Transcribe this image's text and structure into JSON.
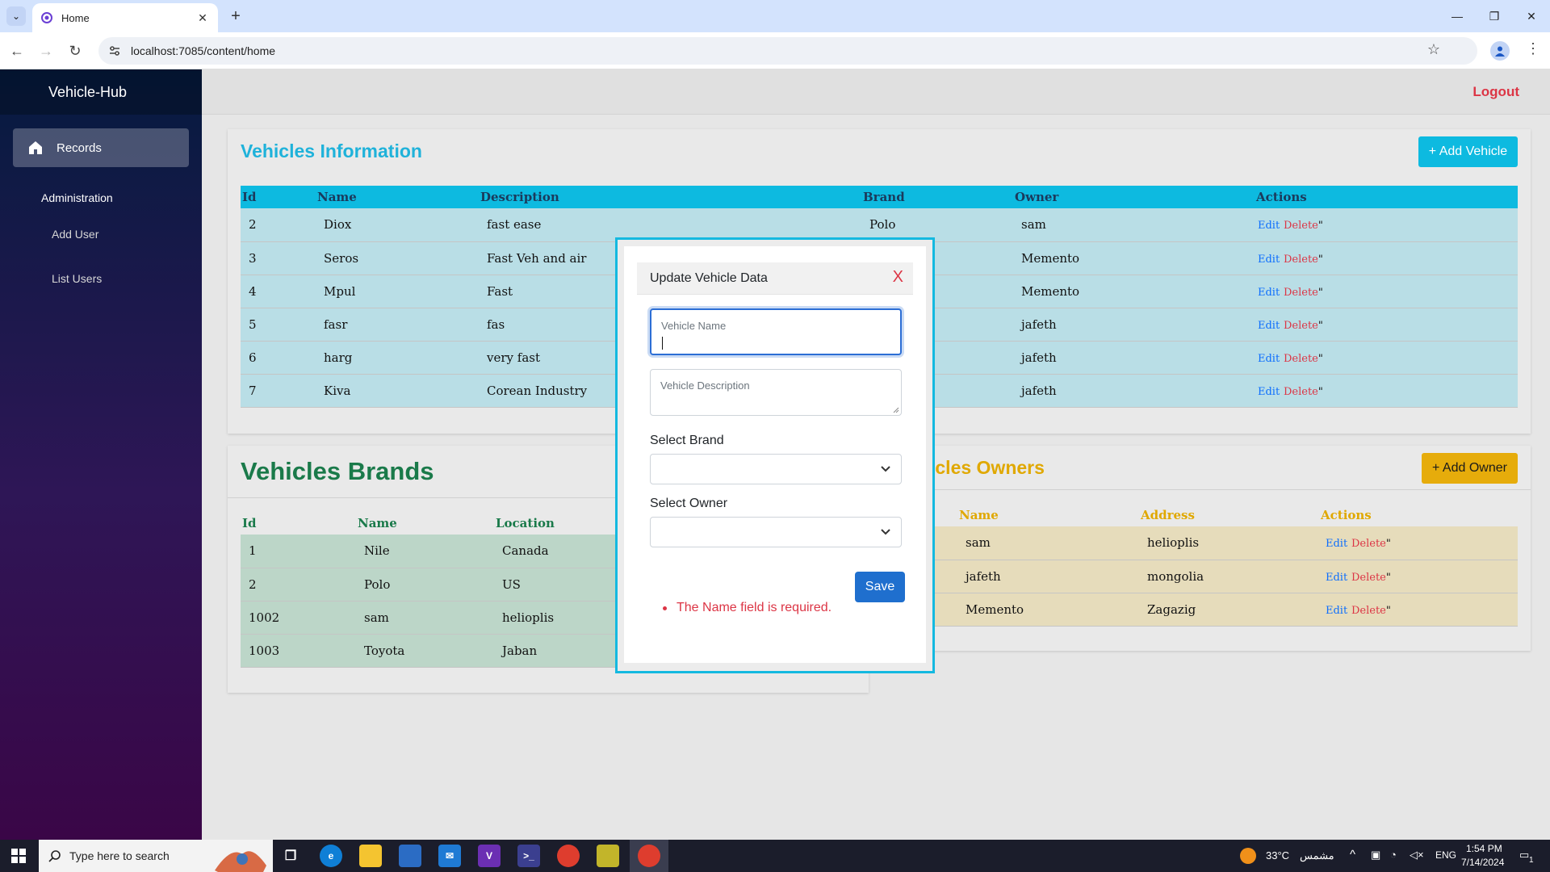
{
  "browser": {
    "tab_title": "Home",
    "url": "localhost:7085/content/home"
  },
  "sidebar": {
    "brand": "Vehicle-Hub",
    "records_label": "Records",
    "section_label": "Administration",
    "add_user_label": "Add User",
    "list_users_label": "List Users"
  },
  "header": {
    "logout_label": "Logout"
  },
  "vehicles": {
    "title": "Vehicles Information",
    "add_button": "+ Add Vehicle",
    "columns": [
      "Id",
      "Name",
      "Description",
      "Brand",
      "Owner",
      "Actions"
    ],
    "rows": [
      {
        "id": "2",
        "name": "Diox",
        "description": "fast ease",
        "brand": "Polo",
        "owner": "sam"
      },
      {
        "id": "3",
        "name": "Seros",
        "description": "Fast Veh and air",
        "brand": "",
        "owner": "Memento"
      },
      {
        "id": "4",
        "name": "Mpul",
        "description": "Fast",
        "brand": "",
        "owner": "Memento"
      },
      {
        "id": "5",
        "name": "fasr",
        "description": "fas",
        "brand": "",
        "owner": "jafeth"
      },
      {
        "id": "6",
        "name": "harg",
        "description": "very fast",
        "brand": "",
        "owner": "jafeth"
      },
      {
        "id": "7",
        "name": "Kiva",
        "description": "Corean Industry",
        "brand": "",
        "owner": "jafeth"
      }
    ]
  },
  "brands": {
    "title": "Vehicles Brands",
    "columns": [
      "Id",
      "Name",
      "Location"
    ],
    "rows": [
      {
        "id": "1",
        "name": "Nile",
        "location": "Canada"
      },
      {
        "id": "2",
        "name": "Polo",
        "location": "US"
      },
      {
        "id": "1002",
        "name": "sam",
        "location": "helioplis"
      },
      {
        "id": "1003",
        "name": "Toyota",
        "location": "Jaban"
      }
    ]
  },
  "owners": {
    "title": "icles Owners",
    "add_button": "+ Add Owner",
    "columns": [
      "Name",
      "Address",
      "Actions"
    ],
    "rows": [
      {
        "name": "sam",
        "address": "helioplis"
      },
      {
        "name": "jafeth",
        "address": "mongolia"
      },
      {
        "name": "Memento",
        "address": "Zagazig"
      }
    ]
  },
  "actions": {
    "edit": "Edit",
    "delete": "Delete",
    "suffix": "\""
  },
  "modal": {
    "title": "Update Vehicle Data",
    "close": "X",
    "name_placeholder": "Vehicle Name",
    "name_value": "",
    "description_placeholder": "Vehicle Description",
    "brand_label": "Select Brand",
    "brand_value": "",
    "owner_label": "Select Owner",
    "owner_value": "",
    "save_label": "Save",
    "error": "The Name field is required."
  },
  "taskbar": {
    "search_placeholder": "Type here to search",
    "weather": "33°C",
    "weather_label": "مشمس",
    "language": "ENG",
    "time": "1:54 PM",
    "date": "7/14/2024",
    "notification_count": "1"
  },
  "colors": {
    "vehicles_accent": "#0dbae0",
    "brands_accent": "#1a7a4a",
    "owners_accent": "#e0a800",
    "danger": "#dc3545",
    "primary": "#1f6fce"
  }
}
